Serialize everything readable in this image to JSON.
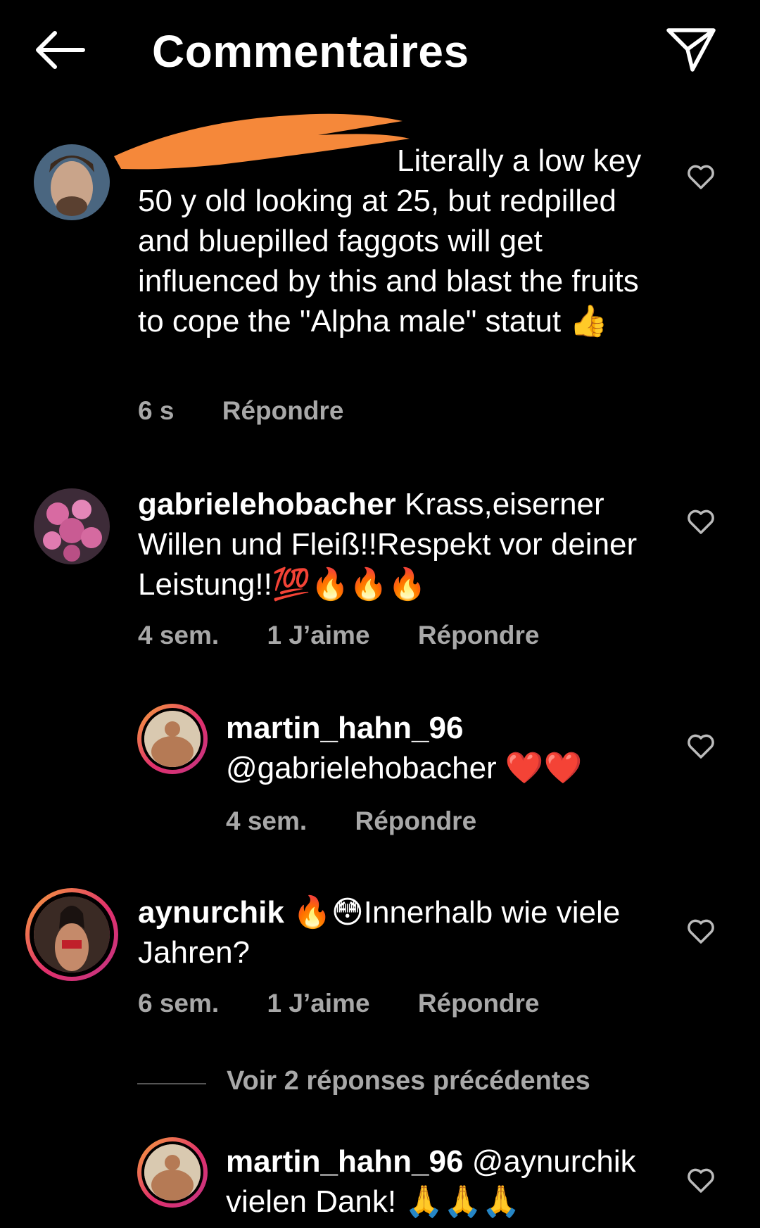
{
  "header": {
    "title": "Commentaires",
    "back_icon": "arrow-left-icon",
    "share_icon": "paper-plane-icon"
  },
  "comments": [
    {
      "username": "",
      "text": "Literally a low key 50 y old looking at 25, but redpilled and bluepilled faggots will get influenced by this and blast the fruits to cope the \"Alpha male\" statut 👍",
      "time": "6 s",
      "likes": "",
      "reply_label": "Répondre",
      "redacted": true
    },
    {
      "username": "gabrielehobacher",
      "text": "Krass,eiserner Willen und Fleiß!!Respekt vor deiner Leistung!!💯🔥🔥🔥",
      "time": "4 sem.",
      "likes": "1 J’aime",
      "reply_label": "Répondre"
    },
    {
      "username": "martin_hahn_96",
      "text": "@gabrielehobacher ❤️❤️",
      "time": "4 sem.",
      "likes": "",
      "reply_label": "Répondre"
    },
    {
      "username": "aynurchik",
      "text": "🔥😳Innerhalb wie viele Jahren?",
      "time": "6 sem.",
      "likes": "1 J’aime",
      "reply_label": "Répondre"
    },
    {
      "username": "martin_hahn_96",
      "text": "@aynurchik vielen Dank! 🙏🙏🙏",
      "time": "",
      "likes": "",
      "reply_label": ""
    }
  ],
  "see_previous": "Voir 2 réponses précédentes",
  "colors": {
    "background": "#000000",
    "meta_text": "#a8a8a8",
    "story_ring_start": "#f7a43a",
    "story_ring_end": "#c13584",
    "redaction": "#f5883a"
  }
}
